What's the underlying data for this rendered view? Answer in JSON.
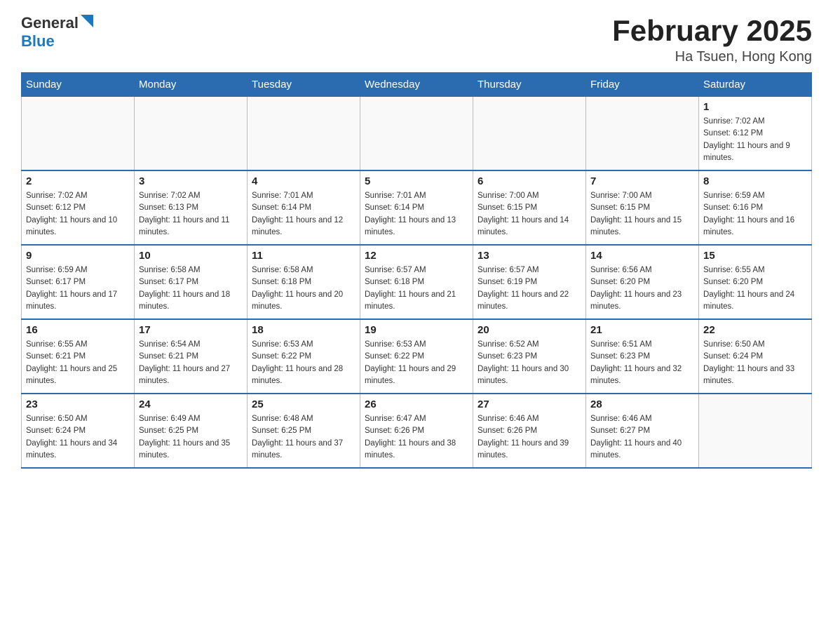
{
  "header": {
    "logo_general": "General",
    "logo_blue": "Blue",
    "month_year": "February 2025",
    "location": "Ha Tsuen, Hong Kong"
  },
  "weekdays": [
    "Sunday",
    "Monday",
    "Tuesday",
    "Wednesday",
    "Thursday",
    "Friday",
    "Saturday"
  ],
  "weeks": [
    [
      {
        "day": "",
        "sunrise": "",
        "sunset": "",
        "daylight": ""
      },
      {
        "day": "",
        "sunrise": "",
        "sunset": "",
        "daylight": ""
      },
      {
        "day": "",
        "sunrise": "",
        "sunset": "",
        "daylight": ""
      },
      {
        "day": "",
        "sunrise": "",
        "sunset": "",
        "daylight": ""
      },
      {
        "day": "",
        "sunrise": "",
        "sunset": "",
        "daylight": ""
      },
      {
        "day": "",
        "sunrise": "",
        "sunset": "",
        "daylight": ""
      },
      {
        "day": "1",
        "sunrise": "Sunrise: 7:02 AM",
        "sunset": "Sunset: 6:12 PM",
        "daylight": "Daylight: 11 hours and 9 minutes."
      }
    ],
    [
      {
        "day": "2",
        "sunrise": "Sunrise: 7:02 AM",
        "sunset": "Sunset: 6:12 PM",
        "daylight": "Daylight: 11 hours and 10 minutes."
      },
      {
        "day": "3",
        "sunrise": "Sunrise: 7:02 AM",
        "sunset": "Sunset: 6:13 PM",
        "daylight": "Daylight: 11 hours and 11 minutes."
      },
      {
        "day": "4",
        "sunrise": "Sunrise: 7:01 AM",
        "sunset": "Sunset: 6:14 PM",
        "daylight": "Daylight: 11 hours and 12 minutes."
      },
      {
        "day": "5",
        "sunrise": "Sunrise: 7:01 AM",
        "sunset": "Sunset: 6:14 PM",
        "daylight": "Daylight: 11 hours and 13 minutes."
      },
      {
        "day": "6",
        "sunrise": "Sunrise: 7:00 AM",
        "sunset": "Sunset: 6:15 PM",
        "daylight": "Daylight: 11 hours and 14 minutes."
      },
      {
        "day": "7",
        "sunrise": "Sunrise: 7:00 AM",
        "sunset": "Sunset: 6:15 PM",
        "daylight": "Daylight: 11 hours and 15 minutes."
      },
      {
        "day": "8",
        "sunrise": "Sunrise: 6:59 AM",
        "sunset": "Sunset: 6:16 PM",
        "daylight": "Daylight: 11 hours and 16 minutes."
      }
    ],
    [
      {
        "day": "9",
        "sunrise": "Sunrise: 6:59 AM",
        "sunset": "Sunset: 6:17 PM",
        "daylight": "Daylight: 11 hours and 17 minutes."
      },
      {
        "day": "10",
        "sunrise": "Sunrise: 6:58 AM",
        "sunset": "Sunset: 6:17 PM",
        "daylight": "Daylight: 11 hours and 18 minutes."
      },
      {
        "day": "11",
        "sunrise": "Sunrise: 6:58 AM",
        "sunset": "Sunset: 6:18 PM",
        "daylight": "Daylight: 11 hours and 20 minutes."
      },
      {
        "day": "12",
        "sunrise": "Sunrise: 6:57 AM",
        "sunset": "Sunset: 6:18 PM",
        "daylight": "Daylight: 11 hours and 21 minutes."
      },
      {
        "day": "13",
        "sunrise": "Sunrise: 6:57 AM",
        "sunset": "Sunset: 6:19 PM",
        "daylight": "Daylight: 11 hours and 22 minutes."
      },
      {
        "day": "14",
        "sunrise": "Sunrise: 6:56 AM",
        "sunset": "Sunset: 6:20 PM",
        "daylight": "Daylight: 11 hours and 23 minutes."
      },
      {
        "day": "15",
        "sunrise": "Sunrise: 6:55 AM",
        "sunset": "Sunset: 6:20 PM",
        "daylight": "Daylight: 11 hours and 24 minutes."
      }
    ],
    [
      {
        "day": "16",
        "sunrise": "Sunrise: 6:55 AM",
        "sunset": "Sunset: 6:21 PM",
        "daylight": "Daylight: 11 hours and 25 minutes."
      },
      {
        "day": "17",
        "sunrise": "Sunrise: 6:54 AM",
        "sunset": "Sunset: 6:21 PM",
        "daylight": "Daylight: 11 hours and 27 minutes."
      },
      {
        "day": "18",
        "sunrise": "Sunrise: 6:53 AM",
        "sunset": "Sunset: 6:22 PM",
        "daylight": "Daylight: 11 hours and 28 minutes."
      },
      {
        "day": "19",
        "sunrise": "Sunrise: 6:53 AM",
        "sunset": "Sunset: 6:22 PM",
        "daylight": "Daylight: 11 hours and 29 minutes."
      },
      {
        "day": "20",
        "sunrise": "Sunrise: 6:52 AM",
        "sunset": "Sunset: 6:23 PM",
        "daylight": "Daylight: 11 hours and 30 minutes."
      },
      {
        "day": "21",
        "sunrise": "Sunrise: 6:51 AM",
        "sunset": "Sunset: 6:23 PM",
        "daylight": "Daylight: 11 hours and 32 minutes."
      },
      {
        "day": "22",
        "sunrise": "Sunrise: 6:50 AM",
        "sunset": "Sunset: 6:24 PM",
        "daylight": "Daylight: 11 hours and 33 minutes."
      }
    ],
    [
      {
        "day": "23",
        "sunrise": "Sunrise: 6:50 AM",
        "sunset": "Sunset: 6:24 PM",
        "daylight": "Daylight: 11 hours and 34 minutes."
      },
      {
        "day": "24",
        "sunrise": "Sunrise: 6:49 AM",
        "sunset": "Sunset: 6:25 PM",
        "daylight": "Daylight: 11 hours and 35 minutes."
      },
      {
        "day": "25",
        "sunrise": "Sunrise: 6:48 AM",
        "sunset": "Sunset: 6:25 PM",
        "daylight": "Daylight: 11 hours and 37 minutes."
      },
      {
        "day": "26",
        "sunrise": "Sunrise: 6:47 AM",
        "sunset": "Sunset: 6:26 PM",
        "daylight": "Daylight: 11 hours and 38 minutes."
      },
      {
        "day": "27",
        "sunrise": "Sunrise: 6:46 AM",
        "sunset": "Sunset: 6:26 PM",
        "daylight": "Daylight: 11 hours and 39 minutes."
      },
      {
        "day": "28",
        "sunrise": "Sunrise: 6:46 AM",
        "sunset": "Sunset: 6:27 PM",
        "daylight": "Daylight: 11 hours and 40 minutes."
      },
      {
        "day": "",
        "sunrise": "",
        "sunset": "",
        "daylight": ""
      }
    ]
  ]
}
